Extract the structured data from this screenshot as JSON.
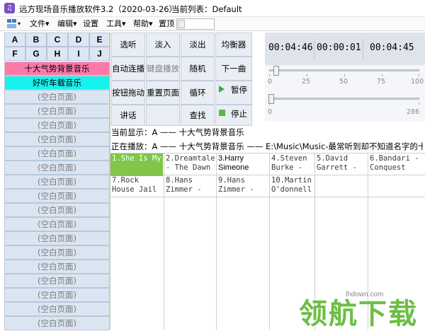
{
  "window": {
    "title": "远方现场音乐播放软件3.2（2020-03-26）",
    "playlist_label": "当前列表：Default",
    "icon": "music-note-icon"
  },
  "menubar": {
    "items": [
      {
        "label": "文件▾"
      },
      {
        "label": "编辑▾"
      },
      {
        "label": "设置"
      },
      {
        "label": "工具▾"
      },
      {
        "label": "帮助▾"
      },
      {
        "label": "置顶"
      }
    ],
    "layout_icon": "layout-icon"
  },
  "letters": [
    "A",
    "B",
    "C",
    "D",
    "E",
    "F",
    "G",
    "H",
    "I",
    "J"
  ],
  "playlists": [
    {
      "label": "十大气势背景音乐",
      "color": "#ff79a8"
    },
    {
      "label": "好听车载音乐",
      "color": "#16f2ee"
    }
  ],
  "blank_pages": {
    "label": "(空白页面)",
    "count": 16
  },
  "controls": [
    {
      "label": "选听"
    },
    {
      "label": "淡入"
    },
    {
      "label": "淡出"
    },
    {
      "label": "均衡器"
    },
    {
      "label": "自动连播"
    },
    {
      "label": "键盘播放"
    },
    {
      "label": "随机"
    },
    {
      "label": "下一曲"
    },
    {
      "label": "按钮拖动"
    },
    {
      "label": "重置页面"
    },
    {
      "label": "循环"
    },
    {
      "label": "暂停"
    },
    {
      "label": "讲话"
    },
    {
      "label": ""
    },
    {
      "label": "查找"
    },
    {
      "label": "停止"
    }
  ],
  "times": {
    "elapsed": "00:04:46",
    "current": "00:00:01",
    "total": "00:04:45"
  },
  "volume": {
    "ticks": [
      "0",
      "25",
      "50",
      "75",
      "100"
    ],
    "value": 2
  },
  "seek": {
    "ticks": [
      "0",
      "286"
    ],
    "value": 1
  },
  "info": {
    "display": "当前显示：A —— 十大气势背景音乐",
    "playing": "正在播放：A —— 十大气势背景音乐 —— E:\\Music\\Music-最常听到却不知道名字的十大气"
  },
  "tracks": [
    {
      "text": "1.She Is My",
      "state": "active"
    },
    {
      "text": "2.Dreamtale - The Dawn",
      "state": ""
    },
    {
      "text": "3.Harry Simeone",
      "state": "sel"
    },
    {
      "text": "4.Steven Burke -",
      "state": ""
    },
    {
      "text": "5.David Garrett -",
      "state": ""
    },
    {
      "text": "6.Bandari - Conquest",
      "state": ""
    },
    {
      "text": "7.Rock House Jail",
      "state": ""
    },
    {
      "text": "8.Hans Zimmer -",
      "state": ""
    },
    {
      "text": "9.Hans Zimmer -",
      "state": ""
    },
    {
      "text": "10.Martin O'donnell",
      "state": ""
    }
  ],
  "watermark": {
    "site": "lhdown.com",
    "text": "领航下载"
  }
}
